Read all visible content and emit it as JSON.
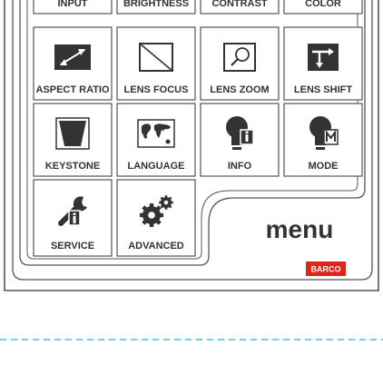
{
  "keypad": {
    "buttons": [
      {
        "id": "input",
        "label": "INPUT",
        "icon": "input-icon"
      },
      {
        "id": "brightness",
        "label": "BRIGHTNESS",
        "icon": "brightness-icon"
      },
      {
        "id": "contrast",
        "label": "CONTRAST",
        "icon": "contrast-icon"
      },
      {
        "id": "color",
        "label": "COLOR",
        "icon": "color-icon"
      },
      {
        "id": "aspect-ratio",
        "label": "ASPECT RATIO",
        "icon": "aspect-ratio-icon"
      },
      {
        "id": "lens-focus",
        "label": "LENS FOCUS",
        "icon": "lens-focus-icon"
      },
      {
        "id": "lens-zoom",
        "label": "LENS ZOOM",
        "icon": "magnifier-icon"
      },
      {
        "id": "lens-shift",
        "label": "LENS SHIFT",
        "icon": "lens-shift-icon"
      },
      {
        "id": "keystone",
        "label": "KEYSTONE",
        "icon": "keystone-icon"
      },
      {
        "id": "language",
        "label": "LANGUAGE",
        "icon": "world-map-icon"
      },
      {
        "id": "info",
        "label": "INFO",
        "icon": "info-bulb-icon"
      },
      {
        "id": "mode",
        "label": "MODE",
        "icon": "mode-bulb-icon"
      },
      {
        "id": "service",
        "label": "SERVICE",
        "icon": "wrench-info-icon"
      },
      {
        "id": "advanced",
        "label": "ADVANCED",
        "icon": "gears-icon"
      }
    ],
    "menu_label": "menu",
    "brand": "BARCO"
  },
  "colors": {
    "outline": "#555555",
    "icon_dark": "#333333",
    "brand_red": "#e2231a",
    "dash": "#3fc3d8"
  }
}
